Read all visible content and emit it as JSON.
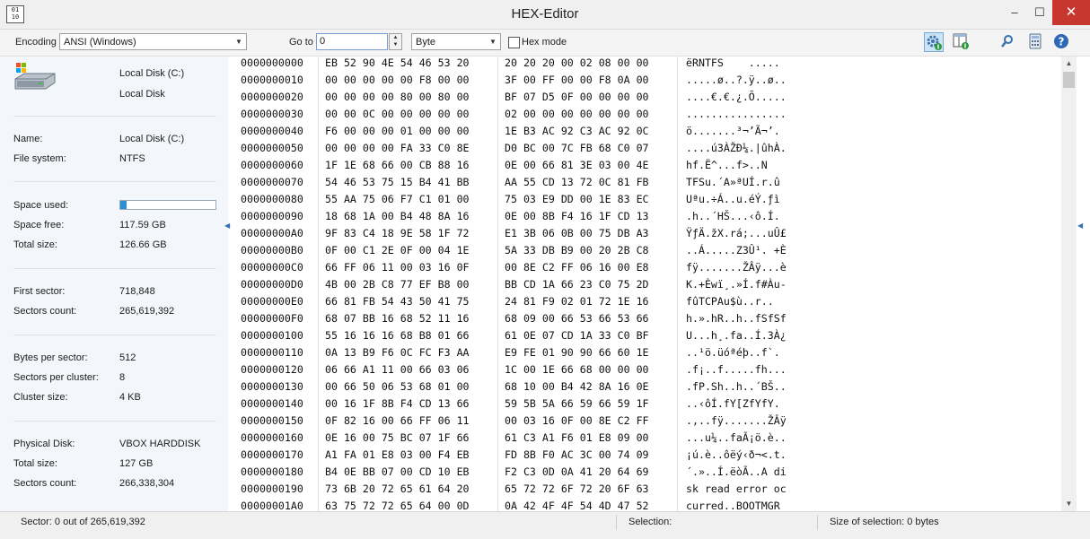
{
  "window": {
    "title": "HEX-Editor",
    "app_icon_text": "01\n10",
    "controls": {
      "minimize": "–",
      "maximize": "☐",
      "close": "✕"
    }
  },
  "toolbar": {
    "encoding_label": "Encoding",
    "encoding_value": "ANSI (Windows)",
    "goto_label": "Go to",
    "goto_value": "0",
    "unit_value": "Byte",
    "hexmode_label": "Hex mode",
    "hexmode_checked": false,
    "icons": [
      "settings-icon",
      "info-panel-icon",
      "search-icon",
      "calculator-icon",
      "help-icon"
    ],
    "accent_color": "#2b8fd6"
  },
  "left_panel": {
    "disk_title": "Local Disk (C:)",
    "disk_subtitle": "Local Disk",
    "groups": [
      [
        {
          "label": "Name:",
          "value": "Local Disk (C:)"
        },
        {
          "label": "File system:",
          "value": "NTFS"
        }
      ],
      [
        {
          "label": "Space used:",
          "value": ""
        },
        {
          "label": "Space free:",
          "value": "117.59 GB"
        },
        {
          "label": "Total size:",
          "value": "126.66 GB"
        }
      ],
      [
        {
          "label": "First sector:",
          "value": "718,848"
        },
        {
          "label": "Sectors count:",
          "value": "265,619,392"
        }
      ],
      [
        {
          "label": "Bytes per sector:",
          "value": "512"
        },
        {
          "label": "Sectors per cluster:",
          "value": "8"
        },
        {
          "label": "Cluster size:",
          "value": "4 KB"
        }
      ],
      [
        {
          "label": "Physical Disk:",
          "value": "VBOX HARDDISK"
        },
        {
          "label": "Total size:",
          "value": "127 GB"
        },
        {
          "label": "Sectors count:",
          "value": "266,338,304"
        }
      ]
    ],
    "space_used_fraction": 0.07
  },
  "hex_rows": [
    {
      "offset": "0000000000",
      "b1": "EB 52 90 4E 54 46 53 20",
      "b2": "20 20 20 00 02 08 00 00",
      "ascii": "ëRNTFS    ....."
    },
    {
      "offset": "0000000010",
      "b1": "00 00 00 00 00 F8 00 00",
      "b2": "3F 00 FF 00 00 F8 0A 00",
      "ascii": ".....ø..?.ÿ..ø.."
    },
    {
      "offset": "0000000020",
      "b1": "00 00 00 00 80 00 80 00",
      "b2": "BF 07 D5 0F 00 00 00 00",
      "ascii": "....€.€.¿.Õ....."
    },
    {
      "offset": "0000000030",
      "b1": "00 00 0C 00 00 00 00 00",
      "b2": "02 00 00 00 00 00 00 00",
      "ascii": "................"
    },
    {
      "offset": "0000000040",
      "b1": "F6 00 00 00 01 00 00 00",
      "b2": "1E B3 AC 92 C3 AC 92 0C",
      "ascii": "ö.......³¬’Ã¬’."
    },
    {
      "offset": "0000000050",
      "b1": "00 00 00 00 FA 33 C0 8E",
      "b2": "D0 BC 00 7C FB 68 C0 07",
      "ascii": "....ú3ÀŽÐ¼.|ûhÀ."
    },
    {
      "offset": "0000000060",
      "b1": "1F 1E 68 66 00 CB 88 16",
      "b2": "0E 00 66 81 3E 03 00 4E",
      "ascii": "hf.Ë^...f>..N"
    },
    {
      "offset": "0000000070",
      "b1": "54 46 53 75 15 B4 41 BB",
      "b2": "AA 55 CD 13 72 0C 81 FB",
      "ascii": "TFSu.´A»ªUÍ.r.û"
    },
    {
      "offset": "0000000080",
      "b1": "55 AA 75 06 F7 C1 01 00",
      "b2": "75 03 E9 DD 00 1E 83 EC",
      "ascii": "Uªu.÷Á..u.éÝ.ƒì"
    },
    {
      "offset": "0000000090",
      "b1": "18 68 1A 00 B4 48 8A 16",
      "b2": "0E 00 8B F4 16 1F CD 13",
      "ascii": ".h..´HŠ...‹ô.Í."
    },
    {
      "offset": "00000000A0",
      "b1": "9F 83 C4 18 9E 58 1F 72",
      "b2": "E1 3B 06 0B 00 75 DB A3",
      "ascii": "ŸƒÄ.žX.rá;...uÛ£"
    },
    {
      "offset": "00000000B0",
      "b1": "0F 00 C1 2E 0F 00 04 1E",
      "b2": "5A 33 DB B9 00 20 2B C8",
      "ascii": "..Á.....Z3Û¹. +È"
    },
    {
      "offset": "00000000C0",
      "b1": "66 FF 06 11 00 03 16 0F",
      "b2": "00 8E C2 FF 06 16 00 E8",
      "ascii": "fÿ.......ŽÂÿ...è"
    },
    {
      "offset": "00000000D0",
      "b1": "4B 00 2B C8 77 EF B8 00",
      "b2": "BB CD 1A 66 23 C0 75 2D",
      "ascii": "K.+Èwï¸.»Í.f#Àu-"
    },
    {
      "offset": "00000000E0",
      "b1": "66 81 FB 54 43 50 41 75",
      "b2": "24 81 F9 02 01 72 1E 16",
      "ascii": "fûTCPAu$ù..r.."
    },
    {
      "offset": "00000000F0",
      "b1": "68 07 BB 16 68 52 11 16",
      "b2": "68 09 00 66 53 66 53 66",
      "ascii": "h.».hR..h..fSfSf"
    },
    {
      "offset": "0000000100",
      "b1": "55 16 16 16 68 B8 01 66",
      "b2": "61 0E 07 CD 1A 33 C0 BF",
      "ascii": "U...h¸.fa..Í.3À¿"
    },
    {
      "offset": "0000000110",
      "b1": "0A 13 B9 F6 0C FC F3 AA",
      "b2": "E9 FE 01 90 90 66 60 1E",
      "ascii": "..¹ö.üóªéþ..f`."
    },
    {
      "offset": "0000000120",
      "b1": "06 66 A1 11 00 66 03 06",
      "b2": "1C 00 1E 66 68 00 00 00",
      "ascii": ".f¡..f.....fh..."
    },
    {
      "offset": "0000000130",
      "b1": "00 66 50 06 53 68 01 00",
      "b2": "68 10 00 B4 42 8A 16 0E",
      "ascii": ".fP.Sh..h..´BŠ.."
    },
    {
      "offset": "0000000140",
      "b1": "00 16 1F 8B F4 CD 13 66",
      "b2": "59 5B 5A 66 59 66 59 1F",
      "ascii": "..‹ôÍ.fY[ZfYfY."
    },
    {
      "offset": "0000000150",
      "b1": "0F 82 16 00 66 FF 06 11",
      "b2": "00 03 16 0F 00 8E C2 FF",
      "ascii": ".‚..fÿ.......ŽÂÿ"
    },
    {
      "offset": "0000000160",
      "b1": "0E 16 00 75 BC 07 1F 66",
      "b2": "61 C3 A1 F6 01 E8 09 00",
      "ascii": "...u¼..faÃ¡ö.è.."
    },
    {
      "offset": "0000000170",
      "b1": "A1 FA 01 E8 03 00 F4 EB",
      "b2": "FD 8B F0 AC 3C 00 74 09",
      "ascii": "¡ú.è..ôëý‹ð¬<.t."
    },
    {
      "offset": "0000000180",
      "b1": "B4 0E BB 07 00 CD 10 EB",
      "b2": "F2 C3 0D 0A 41 20 64 69",
      "ascii": "´.»..Í.ëòÃ..A di"
    },
    {
      "offset": "0000000190",
      "b1": "73 6B 20 72 65 61 64 20",
      "b2": "65 72 72 6F 72 20 6F 63",
      "ascii": "sk read error oc"
    },
    {
      "offset": "00000001A0",
      "b1": "63 75 72 72 65 64 00 0D",
      "b2": "0A 42 4F 4F 54 4D 47 52",
      "ascii": "curred..BOOTMGR"
    }
  ],
  "status": {
    "sector_text": "Sector:  0 out of 265,619,392",
    "selection_text": "Selection:",
    "size_text": "Size of selection:  0 bytes"
  }
}
